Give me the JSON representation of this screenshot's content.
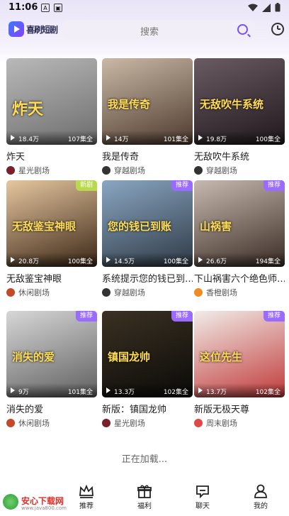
{
  "status": {
    "time": "11:06",
    "left_icons": [
      "A",
      "▣"
    ]
  },
  "app": {
    "logo_text": "喜刷短剧"
  },
  "search": {
    "placeholder": "搜索"
  },
  "cards": [
    {
      "title": "炸天",
      "views": "18.4万",
      "episodes": "107集全",
      "source": "星光剧场",
      "tag": "",
      "poster": "炸天",
      "bg": [
        "#b9b9b9",
        "#6d6d6d"
      ],
      "src_color": "#7a1f2b"
    },
    {
      "title": "我是传奇",
      "views": "14万",
      "episodes": "101集全",
      "source": "穿越剧场",
      "tag": "",
      "poster": "我是传奇",
      "bg": [
        "#c9b9a6",
        "#4e3a2e"
      ],
      "src_color": "#333333"
    },
    {
      "title": "无敌吹牛系统",
      "views": "19.8万",
      "episodes": "100集全",
      "source": "穿越剧场",
      "tag": "",
      "poster": "无敌吹牛系统",
      "bg": [
        "#6a5b63",
        "#20181c"
      ],
      "src_color": "#333333"
    },
    {
      "title": "无敌鉴宝神眼",
      "views": "20.8万",
      "episodes": "100集全",
      "source": "休闲剧场",
      "tag": "新剧",
      "poster": "无敌鉴宝神眼",
      "bg": [
        "#e6c7a0",
        "#3c2716"
      ],
      "src_color": "#c24a2a"
    },
    {
      "title": "系统提示您的钱已到…",
      "views": "14.5万",
      "episodes": "100集全",
      "source": "穿越剧场",
      "tag": "推荐",
      "poster": "您的钱已到账",
      "bg": [
        "#8aa6c2",
        "#2f3a46"
      ],
      "src_color": "#333333"
    },
    {
      "title": "下山祸害六个绝色师…",
      "views": "26.6万",
      "episodes": "194集全",
      "source": "香橙剧场",
      "tag": "推荐",
      "poster": "山祸害",
      "bg": [
        "#c8b9b0",
        "#3a2b24"
      ],
      "src_color": "#f08a24"
    },
    {
      "title": "消失的爱",
      "views": "9万",
      "episodes": "101集全",
      "source": "休闲剧场",
      "tag": "推荐",
      "poster": "消失的爱",
      "bg": [
        "#d7d7d7",
        "#5f5f5f"
      ],
      "src_color": "#c24a2a"
    },
    {
      "title": "新版：镇国龙帅",
      "views": "13.3万",
      "episodes": "102集全",
      "source": "星光剧场",
      "tag": "推荐",
      "poster": "镇国龙帅",
      "bg": [
        "#3b3123",
        "#0b0a08"
      ],
      "src_color": "#7a1f2b"
    },
    {
      "title": "新版无极天尊",
      "views": "13.7万",
      "episodes": "102集全",
      "source": "周末剧场",
      "tag": "推荐",
      "poster": "这位先生",
      "bg": [
        "#f1ece8",
        "#c03a3a"
      ],
      "src_color": "#e04848"
    }
  ],
  "loading_text": "正在加载...",
  "tabs": [
    {
      "label": "推荐"
    },
    {
      "label": "福利"
    },
    {
      "label": "聊天"
    },
    {
      "label": "我的"
    }
  ],
  "watermark": {
    "text": "安心下载网",
    "url": "www.java800.com"
  }
}
